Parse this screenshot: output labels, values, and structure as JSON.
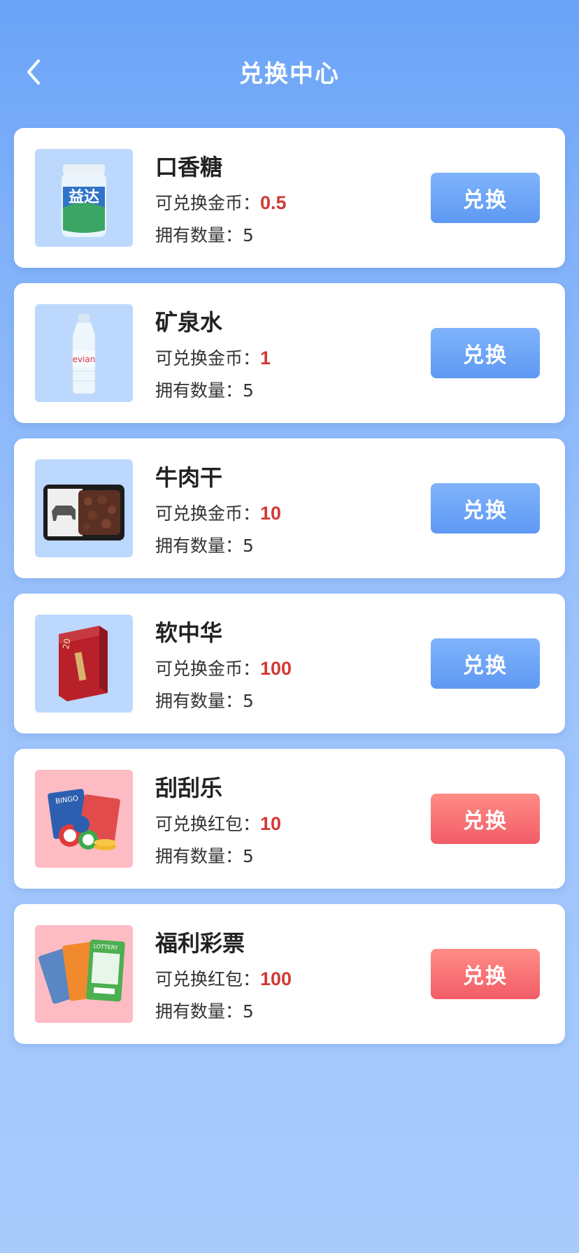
{
  "header": {
    "title": "兑换中心"
  },
  "items": [
    {
      "name": "口香糖",
      "price_label": "可兑换金币：",
      "price": "0.5",
      "qty_label": "拥有数量：",
      "qty": "5",
      "button": "兑换",
      "thumb_icon": "chewing-gum-bottle-icon"
    },
    {
      "name": "矿泉水",
      "price_label": "可兑换金币：",
      "price": "1",
      "qty_label": "拥有数量：",
      "qty": "5",
      "button": "兑换",
      "thumb_icon": "water-bottle-icon",
      "thumb_text": "evian"
    },
    {
      "name": "牛肉干",
      "price_label": "可兑换金币：",
      "price": "10",
      "qty_label": "拥有数量：",
      "qty": "5",
      "button": "兑换",
      "thumb_icon": "beef-jerky-pack-icon"
    },
    {
      "name": "软中华",
      "price_label": "可兑换金币：",
      "price": "100",
      "qty_label": "拥有数量：",
      "qty": "5",
      "button": "兑换",
      "thumb_icon": "cigarette-pack-icon",
      "thumb_text": "20"
    },
    {
      "name": "刮刮乐",
      "price_label": "可兑换红包：",
      "price": "10",
      "qty_label": "拥有数量：",
      "qty": "5",
      "button": "兑换",
      "thumb_icon": "bingo-card-icon",
      "thumb_text": "BINGO"
    },
    {
      "name": "福利彩票",
      "price_label": "可兑换红包：",
      "price": "100",
      "qty_label": "拥有数量：",
      "qty": "5",
      "button": "兑换",
      "thumb_icon": "lottery-ticket-icon",
      "thumb_text": "LOTTERY"
    }
  ],
  "colors": {
    "price": "#d23a34",
    "button_gold": "#6aa3f6",
    "button_red": "#f6646c",
    "background": "#7fb0f9"
  }
}
